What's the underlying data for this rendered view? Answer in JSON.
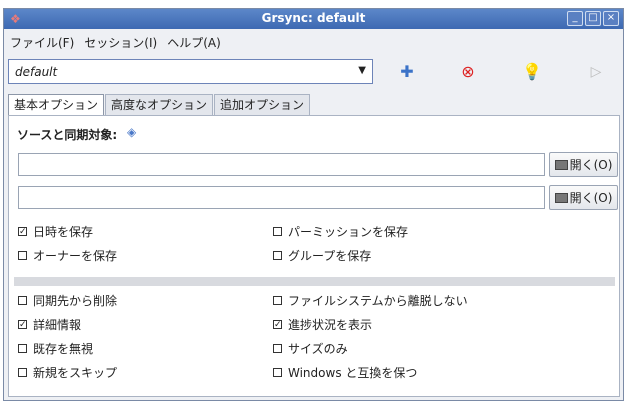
{
  "title": "Grsync: default",
  "menu": [
    "ファイル(F)",
    "セッション(I)",
    "ヘルプ(A)"
  ],
  "session": "default",
  "tabs": [
    "基本オプション",
    "高度なオプション",
    "追加オプション"
  ],
  "source_label": "ソースと同期対象:",
  "open_button": "開く(O)",
  "options": {
    "preserve_time": {
      "label": "日時を保存",
      "checked": true
    },
    "preserve_perm": {
      "label": "パーミッションを保存",
      "checked": false
    },
    "preserve_owner": {
      "label": "オーナーを保存",
      "checked": false
    },
    "preserve_group": {
      "label": "グループを保存",
      "checked": false
    },
    "delete_dest": {
      "label": "同期先から削除",
      "checked": false
    },
    "one_fs": {
      "label": "ファイルシステムから離脱しない",
      "checked": false
    },
    "verbose": {
      "label": "詳細情報",
      "checked": true
    },
    "progress": {
      "label": "進捗状況を表示",
      "checked": true
    },
    "ignore_existing": {
      "label": "既存を無視",
      "checked": false
    },
    "size_only": {
      "label": "サイズのみ",
      "checked": false
    },
    "skip_new": {
      "label": "新規をスキップ",
      "checked": false
    },
    "windows_compat": {
      "label": "Windows と互換を保つ",
      "checked": false
    }
  }
}
